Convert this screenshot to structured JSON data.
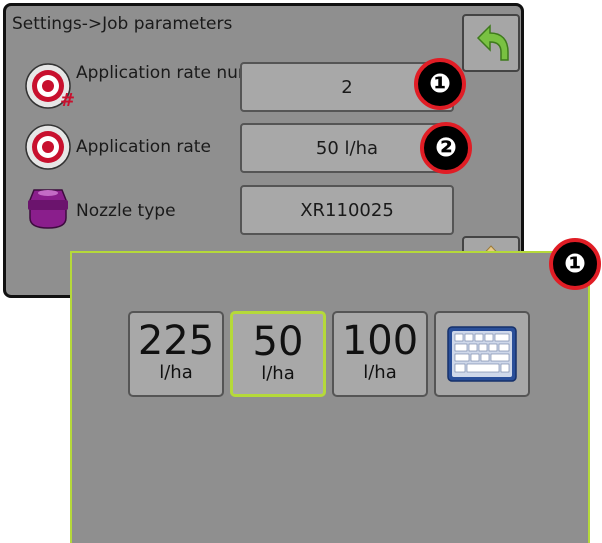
{
  "breadcrumb": "Settings->Job parameters",
  "params": [
    {
      "label": "Application rate number",
      "value": "2",
      "icon": "target-hash-icon"
    },
    {
      "label": "Application rate",
      "value": "50 l/ha",
      "icon": "target-icon"
    },
    {
      "label": "Nozzle type",
      "value": "XR110025",
      "icon": "nozzle-icon"
    }
  ],
  "callouts": [
    "❶",
    "❷",
    "❶"
  ],
  "popup": {
    "presets": [
      {
        "value": "225",
        "unit": "l/ha",
        "selected": false
      },
      {
        "value": "50",
        "unit": "l/ha",
        "selected": true
      },
      {
        "value": "100",
        "unit": "l/ha",
        "selected": false
      }
    ],
    "keyboard_icon": "keyboard-icon"
  },
  "colors": {
    "screen_bg": "#8f8f8f",
    "selected_border": "#b5d93a",
    "callout_ring": "#e01d25",
    "back_arrow": "#79c142"
  }
}
